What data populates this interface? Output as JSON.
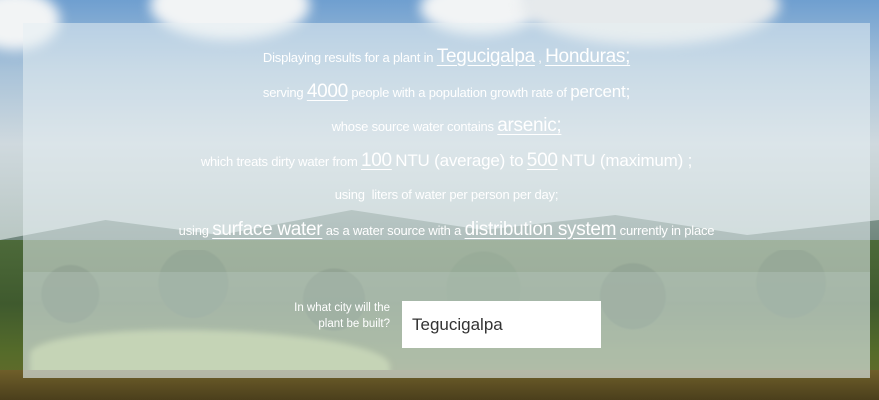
{
  "summary": {
    "line1": {
      "prefix": "Displaying results for a plant in",
      "city": "Tegucigalpa",
      "sep": ",",
      "country": "Honduras;"
    },
    "line2": {
      "prefix": "serving",
      "population": "4000",
      "mid": "people with a population growth rate of",
      "unit": "percent;"
    },
    "line3": {
      "prefix": "whose source water contains",
      "contaminant": "arsenic;"
    },
    "line4": {
      "prefix": "which treats dirty water from",
      "avg_value": "100",
      "avg_text": "NTU (average) to",
      "max_value": "500",
      "max_text": "NTU (maximum) ;"
    },
    "line5": {
      "text": "using  liters of water per person per day;"
    },
    "line6": {
      "prefix": "using",
      "source": "surface water",
      "mid": "as a water source with a",
      "distribution": "distribution system",
      "suffix": "currently in place"
    }
  },
  "form": {
    "question": "In what city will the plant be built?",
    "city_value": "Tegucigalpa"
  }
}
